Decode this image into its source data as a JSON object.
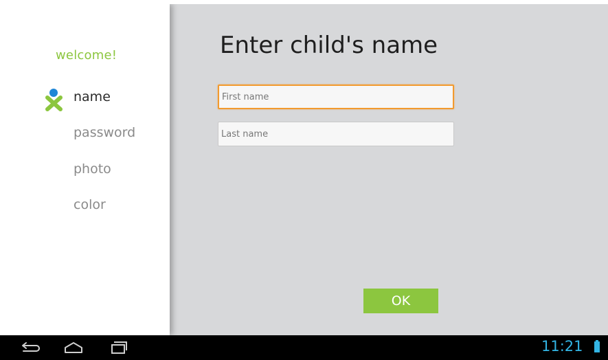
{
  "sidebar": {
    "welcome": "welcome!",
    "steps": [
      {
        "label": "name",
        "active": true,
        "icon": "xo-person-icon"
      },
      {
        "label": "password",
        "active": false
      },
      {
        "label": "photo",
        "active": false
      },
      {
        "label": "color",
        "active": false
      }
    ]
  },
  "main": {
    "title": "Enter child's name",
    "first_name": {
      "placeholder": "First name",
      "value": ""
    },
    "last_name": {
      "placeholder": "Last name",
      "value": ""
    },
    "ok_label": "OK"
  },
  "navbar": {
    "clock": "11:21",
    "buttons": [
      "back-icon",
      "home-icon",
      "recent-apps-icon"
    ]
  },
  "colors": {
    "accent_green": "#8cc63f",
    "focus_orange": "#f29a2e",
    "status_blue": "#33b5e5",
    "xo_blue": "#1f86d6"
  }
}
